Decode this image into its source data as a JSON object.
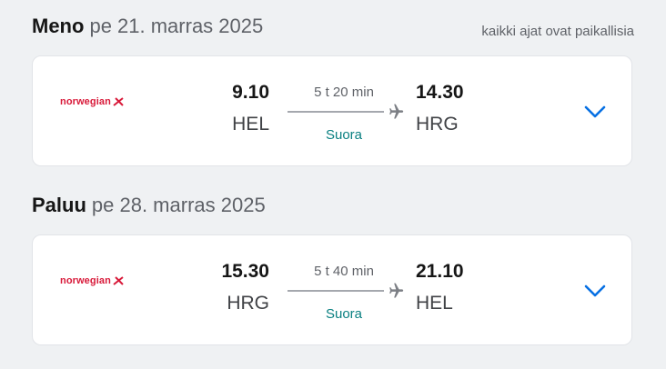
{
  "note": "kaikki ajat ovat paikallisia",
  "outbound": {
    "title": "Meno",
    "date": "pe 21. marras 2025",
    "airline": "norwegian",
    "dep_time": "9.10",
    "dep_airport": "HEL",
    "duration": "5 t 20 min",
    "stops": "Suora",
    "arr_time": "14.30",
    "arr_airport": "HRG"
  },
  "return": {
    "title": "Paluu",
    "date": "pe 28. marras 2025",
    "airline": "norwegian",
    "dep_time": "15.30",
    "dep_airport": "HRG",
    "duration": "5 t 40 min",
    "stops": "Suora",
    "arr_time": "21.10",
    "arr_airport": "HEL"
  },
  "colors": {
    "brand": "#d81939",
    "stops": "#0a8081",
    "chevron": "#0770e3"
  },
  "icons": {
    "plane": "plane-icon",
    "expand": "chevron-down-icon"
  }
}
